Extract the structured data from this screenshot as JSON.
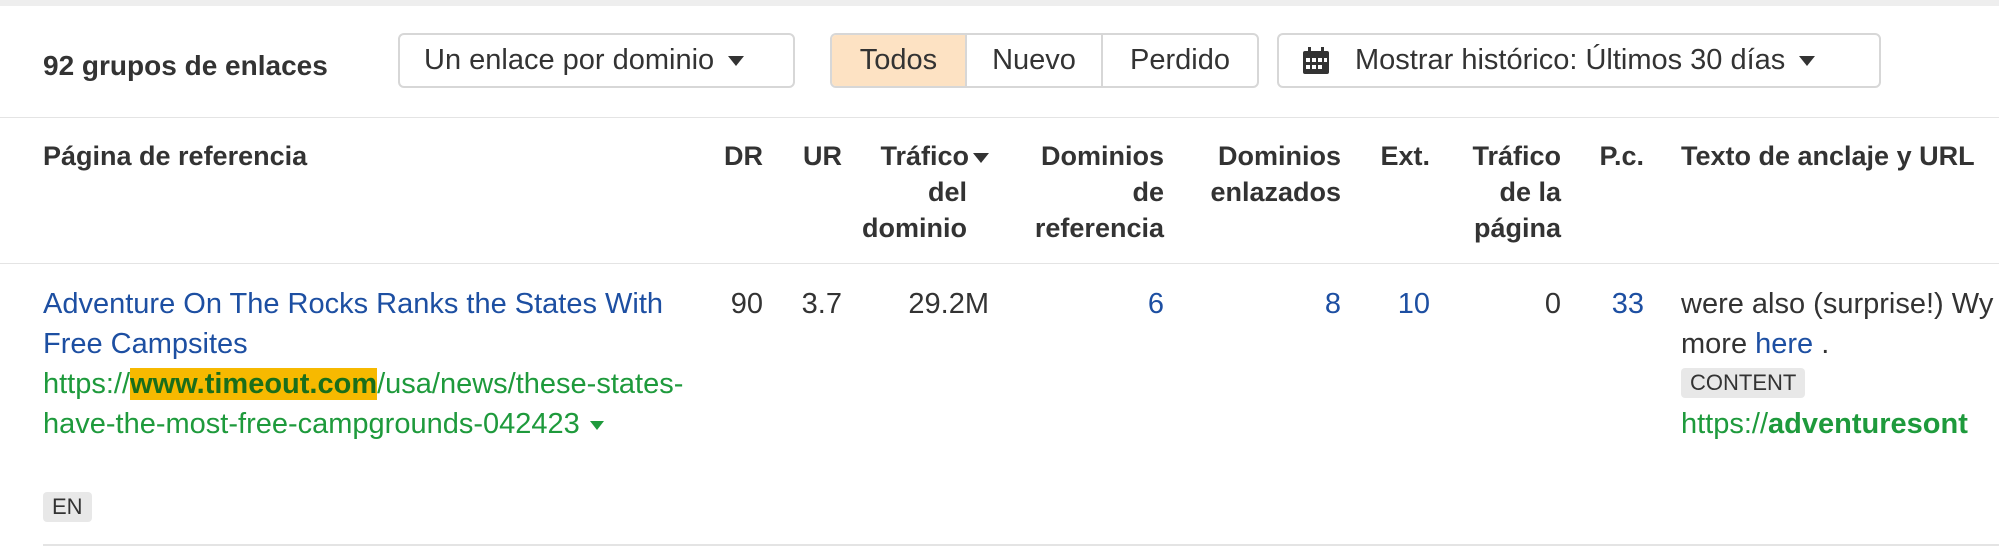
{
  "toolbar": {
    "group_count": "92 grupos de enlaces",
    "link_per_domain_dropdown": "Un enlace por dominio",
    "filter_tabs": [
      "Todos",
      "Nuevo",
      "Perdido"
    ],
    "active_filter": "Todos",
    "history_dropdown": "Mostrar histórico: Últimos 30 días"
  },
  "table": {
    "headers": {
      "referring_page": "Página de referencia",
      "dr": "DR",
      "ur": "UR",
      "domain_traffic": [
        "Tráfico",
        "del",
        "dominio"
      ],
      "referring_domains": [
        "Dominios",
        "de",
        "referencia"
      ],
      "linked_domains": [
        "Dominios",
        "enlazados"
      ],
      "ext": "Ext.",
      "page_traffic": [
        "Tráfico",
        "de la",
        "página"
      ],
      "keywords": "P.c.",
      "anchor_url": "Texto de anclaje y URL"
    },
    "rows": [
      {
        "title": "Adventure On The Rocks Ranks the States With Free Campsites",
        "url_prefix": "https://",
        "url_domain": "www.timeout.com",
        "url_path": "/usa/news/these-states-have-the-most-free-campgrounds-042423",
        "language": "EN",
        "dr": "90",
        "ur": "3.7",
        "domain_traffic": "29.2M",
        "referring_domains": "6",
        "linked_domains": "8",
        "ext": "10",
        "page_traffic": "0",
        "keywords": "33",
        "anchor_line1": "were also (surprise!) Wy",
        "anchor_line2_prefix": "more ",
        "anchor_link": "here",
        "anchor_line2_suffix": " .",
        "anchor_type": "CONTENT",
        "anchor_url_prefix": "https://",
        "anchor_url_domain": "adventuresont"
      }
    ]
  },
  "colors": {
    "link_blue": "#1d4fa2",
    "url_green": "#1e9a3c",
    "highlight": "#f7b900",
    "active_tab": "#fde2c3"
  }
}
